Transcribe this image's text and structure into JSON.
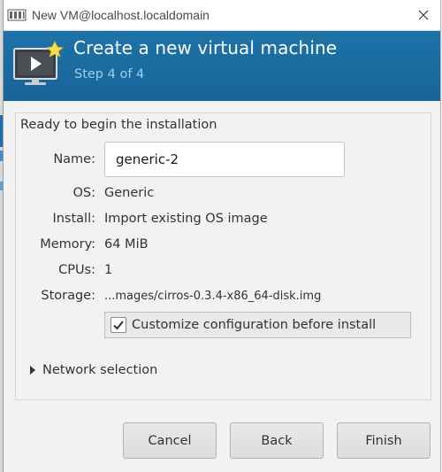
{
  "window": {
    "title": "New VM@localhost.localdomain",
    "close_icon": "close-icon"
  },
  "banner": {
    "title": "Create a new virtual machine",
    "step": "Step 4 of 4"
  },
  "summary": {
    "heading": "Ready to begin the installation",
    "name_label": "Name:",
    "name_value": "generic-2",
    "os_label": "OS:",
    "os_value": "Generic",
    "install_label": "Install:",
    "install_value": "Import existing OS image",
    "memory_label": "Memory:",
    "memory_value": "64 MiB",
    "cpus_label": "CPUs:",
    "cpus_value": "1",
    "storage_label": "Storage:",
    "storage_value": "...mages/cirros-0.3.4-x86_64-disk.img"
  },
  "customize": {
    "label": "Customize configuration before install",
    "checked": true
  },
  "network": {
    "label": "Network selection",
    "expanded": false
  },
  "buttons": {
    "cancel": "Cancel",
    "back": "Back",
    "finish": "Finish"
  },
  "colors": {
    "banner": "#1c6fa3",
    "banner_step_text": "#9fd0ef"
  }
}
